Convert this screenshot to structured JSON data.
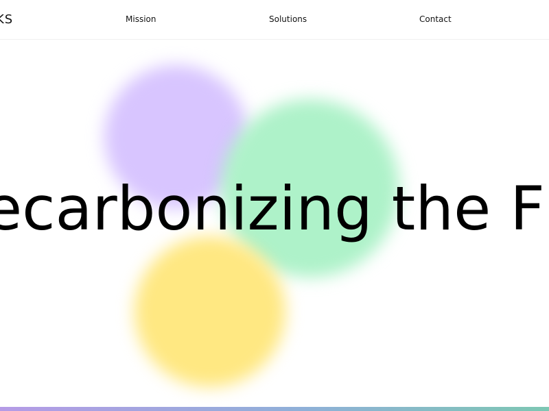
{
  "header": {
    "logo_text": "KS",
    "nav": {
      "mission_label": "Mission",
      "solutions_label": "Solutions",
      "contact_label": "Contact"
    }
  },
  "hero": {
    "headline": "ecarbonizing the F"
  },
  "colors": {
    "purple_blob": "#d8c5ff",
    "green_blob": "#aef2c9",
    "yellow_blob": "#ffe882",
    "strip_start": "#b59be6",
    "strip_end": "#7dc7b3"
  }
}
